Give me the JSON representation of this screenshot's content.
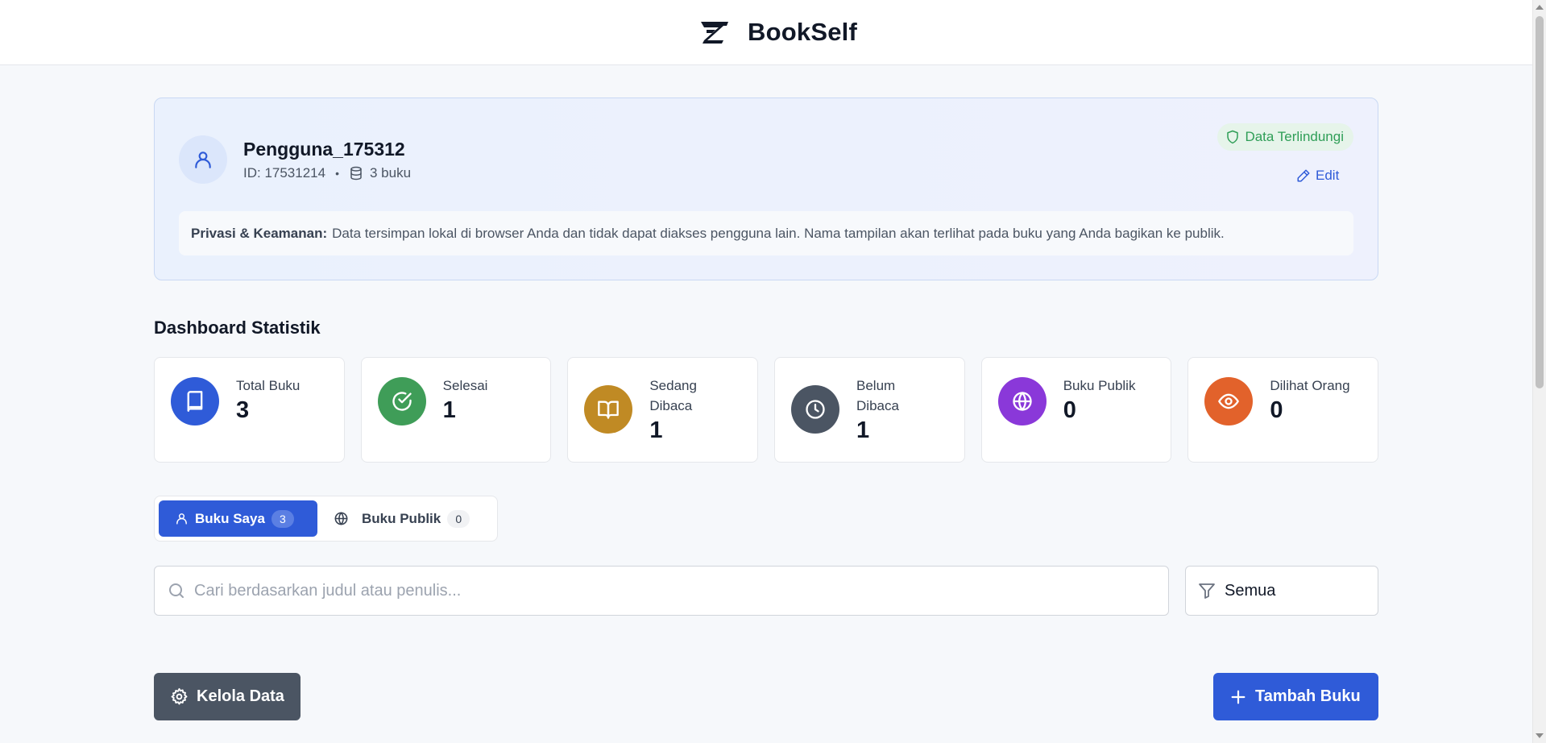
{
  "header": {
    "title": "BookSelf"
  },
  "profile": {
    "username": "Pengguna_175312",
    "id_text": "ID: 17531214",
    "separator": "•",
    "books_text": "3 buku",
    "secure_badge": "Data Terlindungi",
    "edit_label": "Edit",
    "privacy_title": "Privasi & Keamanan:",
    "privacy_text": "Data tersimpan lokal di browser Anda dan tidak dapat diakses pengguna lain. Nama tampilan akan terlihat pada buku yang Anda bagikan ke publik."
  },
  "dashboard": {
    "title": "Dashboard Statistik",
    "stats": [
      {
        "label": "Total Buku",
        "value": "3",
        "color": "#2f5bd8",
        "icon": "book-icon"
      },
      {
        "label": "Selesai",
        "value": "1",
        "color": "#3f9d58",
        "icon": "check-circle-icon"
      },
      {
        "label": "Sedang Dibaca",
        "value": "1",
        "color": "#c08a24",
        "icon": "book-open-icon"
      },
      {
        "label": "Belum Dibaca",
        "value": "1",
        "color": "#4b5563",
        "icon": "clock-icon"
      },
      {
        "label": "Buku Publik",
        "value": "0",
        "color": "#8a38d9",
        "icon": "globe-icon"
      },
      {
        "label": "Dilihat Orang",
        "value": "0",
        "color": "#e2622b",
        "icon": "eye-icon"
      }
    ]
  },
  "tabs": [
    {
      "label": "Buku Saya",
      "count": "3",
      "active": true
    },
    {
      "label": "Buku Publik",
      "count": "0",
      "active": false
    }
  ],
  "search": {
    "placeholder": "Cari berdasarkan judul atau penulis...",
    "value": ""
  },
  "filter": {
    "selected": "Semua"
  },
  "actions": {
    "manage_label": "Kelola Data",
    "add_label": "Tambah Buku"
  },
  "colors": {
    "primary": "#2f5bd8",
    "secondary_button": "#4b5563",
    "secure_green": "#2f9e57"
  }
}
